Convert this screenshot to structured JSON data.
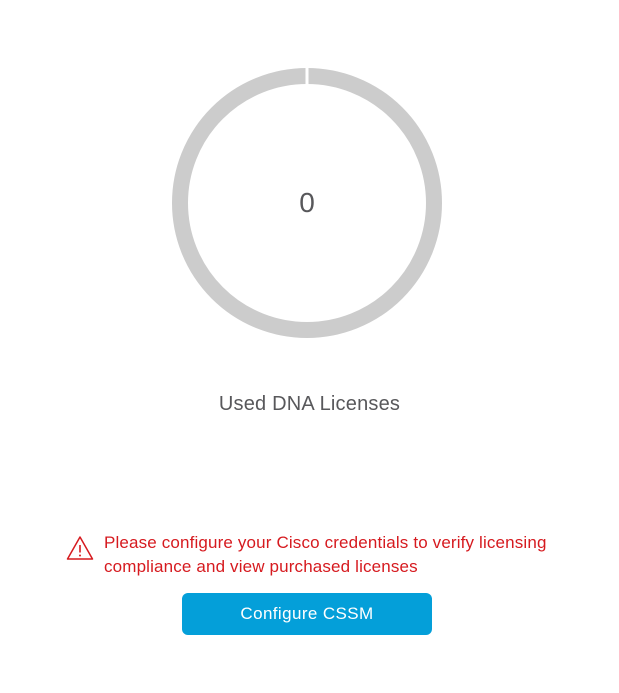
{
  "license_summary": {
    "used_count": "0",
    "label": "Used DNA Licenses",
    "used_fraction": 0,
    "ring_color": "#cccccc",
    "segment_divider_color": "#ffffff"
  },
  "warning": {
    "icon": "warning-triangle-icon",
    "message": "Please configure your Cisco credentials to verify licensing compliance and view purchased licenses",
    "color": "#d61a1f"
  },
  "actions": {
    "configure_label": "Configure CSSM",
    "button_color": "#049fd9"
  }
}
